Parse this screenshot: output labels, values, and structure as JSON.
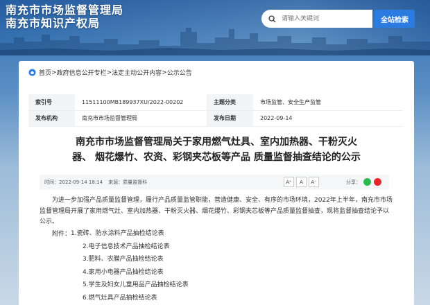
{
  "header": {
    "org_name_1": "南充市市场监督管理局",
    "org_name_2": "南充市知识产权局",
    "search_placeholder": "请输入关键词",
    "search_button": "全站检索"
  },
  "breadcrumb": {
    "items": [
      "首页",
      "政府信息公开专栏",
      "法定主动公开内容",
      "公示公告"
    ],
    "separator": ">"
  },
  "meta": {
    "index_label": "索引号",
    "index_value": "11511100MB189937XU/2022-00202",
    "category_label": "主题分类",
    "category_value": "市场监管、安全生产监管",
    "publisher_label": "发布机构",
    "publisher_value": "南充市市场监督管理局",
    "date_label": "发布日期",
    "date_value": "2022-09-14"
  },
  "article": {
    "title_line1": "南充市市场监督管理局关于家用燃气灶具、室内加热器、干粉灭火",
    "title_line2": "器、 烟花爆竹、农资、彩钢夹芯板等产品 质量监督抽查结论的公示",
    "time_text": "时间：2022-09-14 18:14",
    "source_text": "来源：质量监督科",
    "font_large": "A⁺",
    "font_medium": "A",
    "font_small": "A⁻",
    "share_label": "分享：",
    "intro": "为进一步加强产品质量监督管理，履行产品质量监管职能，营造健康、安全、有序的市场环境，2022年上半年，南充市市场监督管理局开展了家用燃气灶、室内加热器、干粉灭火器、烟花爆竹、彩钢夹芯板等产品质量监督抽查，现将监督抽查结论予以公示。",
    "attachments_label": "附件：",
    "attachments": [
      "1.瓷砖、防水涂料产品抽检结论表",
      "2.电子信息技术产品抽检结论表",
      "3.肥料、农膜产品抽检结论表",
      "4.家用小电器产品抽检结论表",
      "5.学生及妇女儿童用品产品抽检结论表",
      "6.燃气灶具产品抽检结论表"
    ]
  },
  "colors": {
    "accent": "#2c7be0",
    "wechat": "#2dbb4d",
    "weibo": "#e6262d"
  },
  "icons": [
    "home-icon",
    "search-icon",
    "wechat-icon",
    "weibo-icon"
  ]
}
